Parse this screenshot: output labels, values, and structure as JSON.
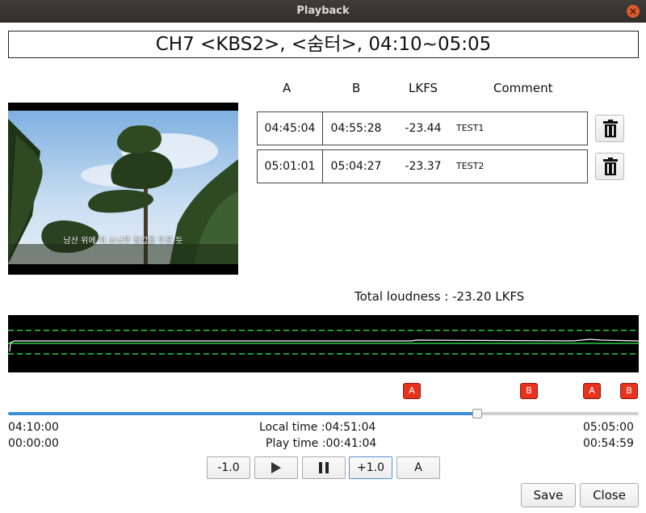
{
  "window": {
    "title": "Playback"
  },
  "channel_title": "CH7 <KBS2>, <숨터>, 04:10~05:05",
  "table": {
    "headers": {
      "a": "A",
      "b": "B",
      "lkfs": "LKFS",
      "comment": "Comment"
    },
    "rows": [
      {
        "a": "04:45:04",
        "b": "04:55:28",
        "lkfs": "-23.44",
        "comment": "TEST1"
      },
      {
        "a": "05:01:01",
        "b": "05:04:27",
        "lkfs": "-23.37",
        "comment": "TEST2"
      }
    ]
  },
  "video": {
    "subtitle": "남산 위에 저 소나무 철갑을 두른 듯"
  },
  "total_loudness": "Total loudness : -23.20 LKFS",
  "markers": [
    {
      "label": "A"
    },
    {
      "label": "B"
    },
    {
      "label": "A"
    },
    {
      "label": "B"
    }
  ],
  "timeline": {
    "progress": 0.744,
    "start_time": "04:10:00",
    "end_time": "05:05:00",
    "start_play": "00:00:00",
    "end_play": "00:54:59",
    "local_time": "Local time :04:51:04",
    "play_time": "Play time :00:41:04"
  },
  "controls": {
    "minus": "-1.0",
    "plus": "+1.0",
    "a": "A"
  },
  "buttons": {
    "save": "Save",
    "close": "Close"
  },
  "colors": {
    "accent": "#3b8fd9",
    "marker": "#e8321e",
    "graph_line": "#2ecc40"
  }
}
